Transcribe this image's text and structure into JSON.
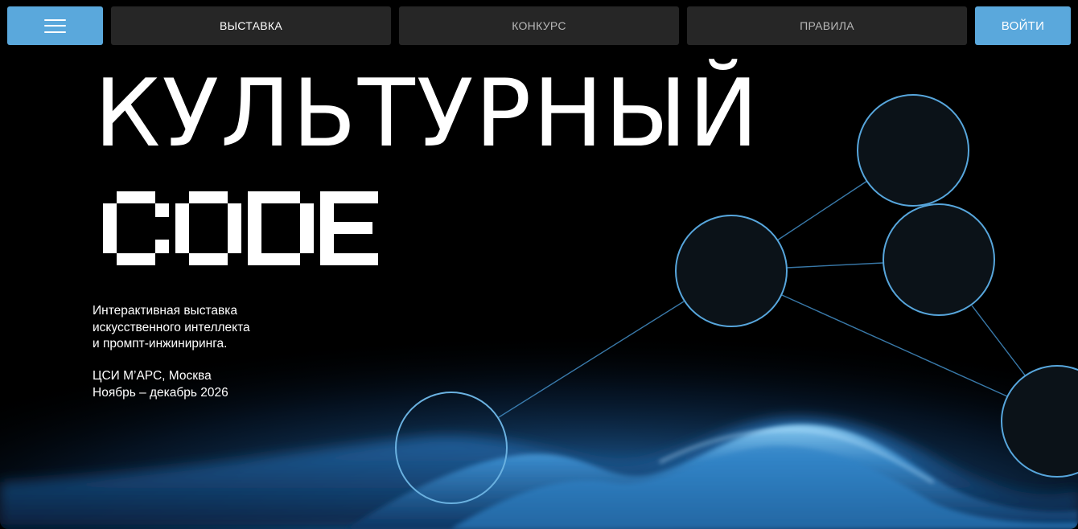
{
  "nav": {
    "menu_icon": "hamburger-icon",
    "tabs": [
      {
        "label": "ВЫСТАВКА",
        "active": true
      },
      {
        "label": "КОНКУРС",
        "active": false
      },
      {
        "label": "ПРАВИЛА",
        "active": false
      }
    ],
    "login_label": "ВОЙТИ"
  },
  "hero": {
    "title_line1": "КУЛЬТУРНЫЙ",
    "title_line2": "CODE",
    "description": [
      "Интерактивная выставка",
      "искусственного интеллекта",
      "и промпт-инжиниринга."
    ],
    "venue": "ЦСИ М’АРС, Москва",
    "dates": "Ноябрь – декабрь 2026"
  },
  "colors": {
    "accent": "#5aa8dc",
    "tab_bg": "#262626",
    "node_stroke": "#4f9fd6",
    "background": "#000000"
  }
}
